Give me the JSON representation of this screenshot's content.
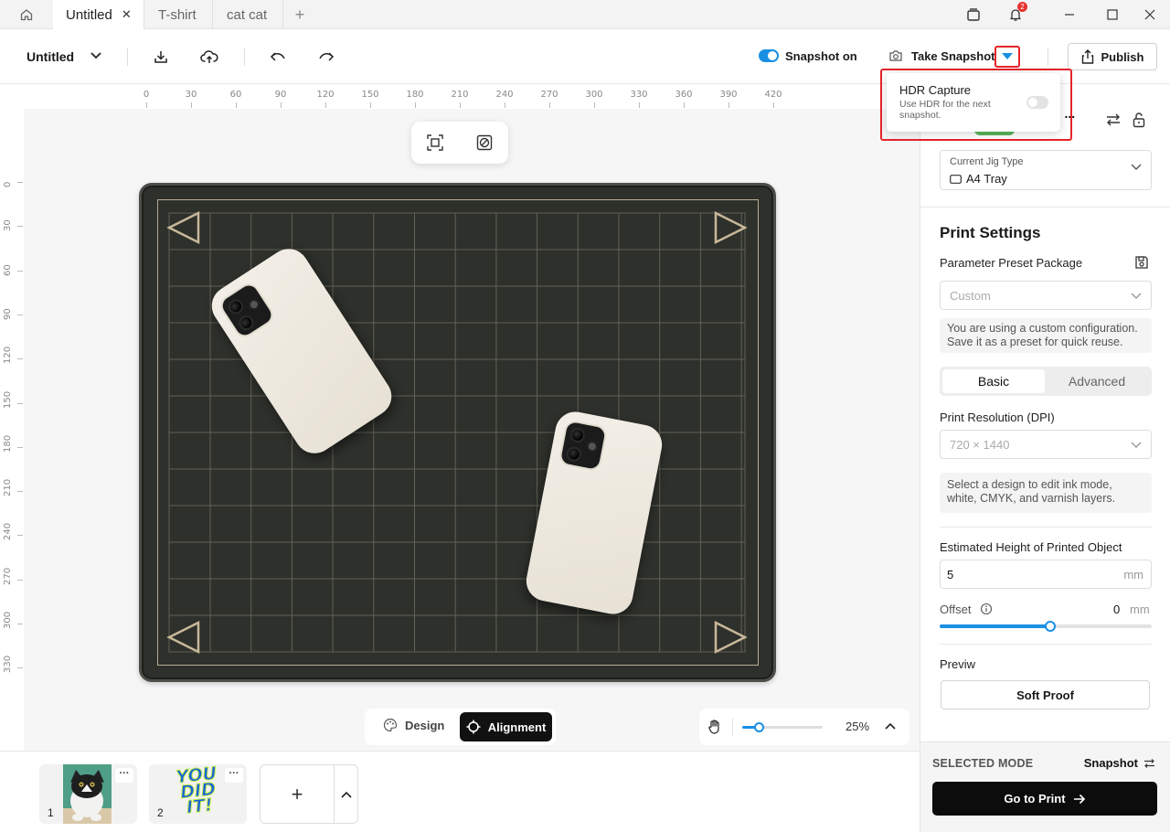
{
  "tabs": [
    {
      "label": "Untitled",
      "active": true
    },
    {
      "label": "T-shirt",
      "active": false
    },
    {
      "label": "cat cat",
      "active": false
    }
  ],
  "tab_close_glyph": "✕",
  "tab_add_glyph": "+",
  "notification_count": "2",
  "toolbar": {
    "doc_name": "Untitled",
    "snapshot_toggle_label": "Snapshot on",
    "snapshot_on": true,
    "take_snapshot_label": "Take Snapshot",
    "publish_label": "Publish"
  },
  "hdr_popover": {
    "title": "HDR Capture",
    "description": "Use HDR for the next snapshot.",
    "enabled": false
  },
  "ruler": {
    "x_labels": [
      "0",
      "30",
      "60",
      "90",
      "120",
      "150",
      "180",
      "210",
      "240",
      "270",
      "300",
      "330",
      "360",
      "390",
      "420"
    ],
    "y_labels": [
      "0",
      "30",
      "60",
      "90",
      "120",
      "150",
      "180",
      "210",
      "240",
      "270",
      "300",
      "330"
    ]
  },
  "canvas": {
    "mode_design_label": "Design",
    "mode_alignment_label": "Alignment",
    "active_mode": "Alignment",
    "zoom_label": "25%",
    "zoom_fraction": 0.2
  },
  "pages": [
    {
      "number": "1",
      "thumb": "cat-photo",
      "more": "···"
    },
    {
      "number": "2",
      "thumb": "you-did-it-sticker",
      "thumb_text": "YOU DID IT!",
      "more": "···"
    }
  ],
  "add_page_glyph": "+",
  "panel": {
    "jig_title_partial": "g ...",
    "jig_label": "Current Jig Type",
    "jig_value": "A4 Tray",
    "print_settings_title": "Print Settings",
    "preset_label": "Parameter Preset Package",
    "preset_value": "Custom",
    "preset_note": "You are using a custom configuration. Save it as a preset for quick reuse.",
    "tab_basic": "Basic",
    "tab_advanced": "Advanced",
    "resolution_label": "Print Resolution (DPI)",
    "resolution_value": "720 × 1440",
    "resolution_note": "Select a design to edit ink mode, white, CMYK, and varnish layers.",
    "height_label": "Estimated Height of Printed Object",
    "height_value": "5",
    "height_unit": "mm",
    "offset_label": "Offset",
    "offset_value": "0",
    "offset_unit": "mm",
    "offset_fraction": 0.52,
    "preview_label": "Previw",
    "soft_proof_label": "Soft Proof",
    "selected_mode_label": "SELECTED MODE",
    "selected_mode_value": "Snapshot",
    "go_to_print_label": "Go to Print"
  },
  "colors": {
    "accent": "#1a8fe3",
    "highlight_frame": "#e5242a",
    "tray": "#2e302b",
    "phone_case": "#ece7dc"
  }
}
